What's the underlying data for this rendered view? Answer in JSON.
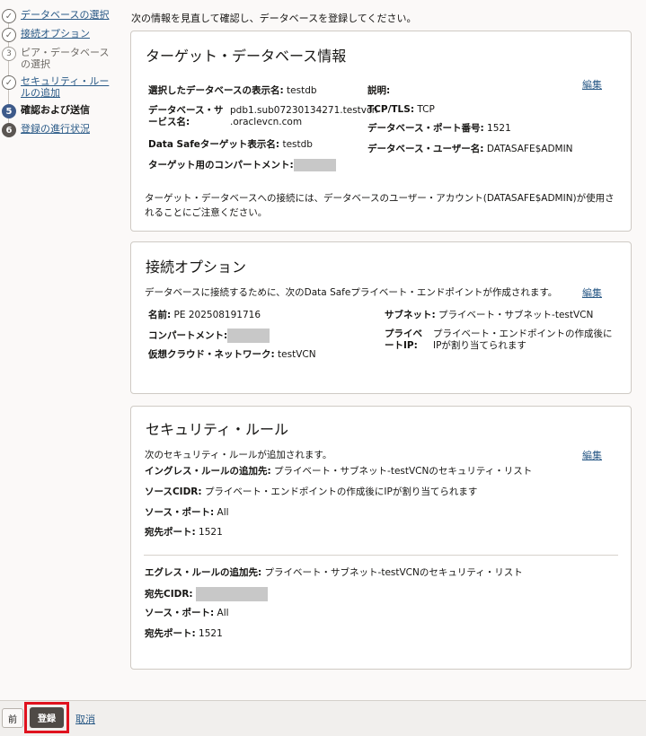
{
  "intro": "次の情報を見直して確認し、データベースを登録してください。",
  "steps": [
    {
      "num": "",
      "label": "データベースの選択",
      "state": "done"
    },
    {
      "num": "",
      "label": "接続オプション",
      "state": "done"
    },
    {
      "num": "3",
      "label": "ピア・データベースの選択",
      "state": "todo"
    },
    {
      "num": "",
      "label": "セキュリティ・ルールの追加",
      "state": "done"
    },
    {
      "num": "5",
      "label": "確認および送信",
      "state": "active"
    },
    {
      "num": "6",
      "label": "登録の進行状況",
      "state": "next"
    }
  ],
  "target_panel": {
    "title": "ターゲット・データベース情報",
    "edit": "編集",
    "display_name_label": "選択したデータベースの表示名:",
    "display_name_value": "testdb",
    "service_label_1": "データベース・サ",
    "service_label_2": "ービス名:",
    "service_value_1": "pdb1.sub07230134271.testvcn",
    "service_value_2": ".oraclevcn.com",
    "ds_target_label": "Data Safeターゲット表示名:",
    "ds_target_value": "testdb",
    "compartment_label": "ターゲット用のコンパートメント:",
    "desc_label": "説明:",
    "tls_label": "TCP/TLS:",
    "tls_value": "TCP",
    "port_label": "データベース・ポート番号:",
    "port_value": "1521",
    "user_label": "データベース・ユーザー名:",
    "user_value": "DATASAFE$ADMIN",
    "note_1": "ターゲット・データベースへの接続には、データベースのユーザー・アカウント(DATASAFE$ADMIN)が使用さ",
    "note_2": "れることにご注意ください。"
  },
  "conn_panel": {
    "title": "接続オプション",
    "edit": "編集",
    "desc": "データベースに接続するために、次のData Safeプライベート・エンドポイントが作成されます。",
    "name_label": "名前:",
    "name_value": "PE 202508191716",
    "compartment_label": "コンパートメント:",
    "vcn_label": "仮想クラウド・ネットワーク:",
    "vcn_value": "testVCN",
    "subnet_label": "サブネット:",
    "subnet_value": "プライベート・サブネット-testVCN",
    "pip_label_1": "プライベ",
    "pip_label_2": "ートIP:",
    "pip_value_1": "プライベート・エンドポイントの作成後に",
    "pip_value_2": "IPが割り当てられます"
  },
  "sec_panel": {
    "title": "セキュリティ・ルール",
    "edit": "編集",
    "desc": "次のセキュリティ・ルールが追加されます。",
    "ingress_label": "イングレス・ルールの追加先:",
    "ingress_value": "プライベート・サブネット-testVCNのセキュリティ・リスト",
    "src_cidr_label": "ソースCIDR:",
    "src_cidr_value": "プライベート・エンドポイントの作成後にIPが割り当てられます",
    "src_port_label": "ソース・ポート:",
    "src_port_value": "All",
    "dst_port_label": "宛先ポート:",
    "dst_port_value": "1521",
    "egress_label": "エグレス・ルールの追加先:",
    "egress_value": "プライベート・サブネット-testVCNのセキュリティ・リスト",
    "dst_cidr_label": "宛先CIDR:",
    "e_src_port_label": "ソース・ポート:",
    "e_src_port_value": "All",
    "e_dst_port_label": "宛先ポート:",
    "e_dst_port_value": "1521"
  },
  "footer": {
    "prev": "前",
    "submit": "登録",
    "cancel": "取消"
  },
  "colors": {
    "accent": "#3d5a8a",
    "link": "#2a5a87",
    "highlight": "#e0121e"
  }
}
